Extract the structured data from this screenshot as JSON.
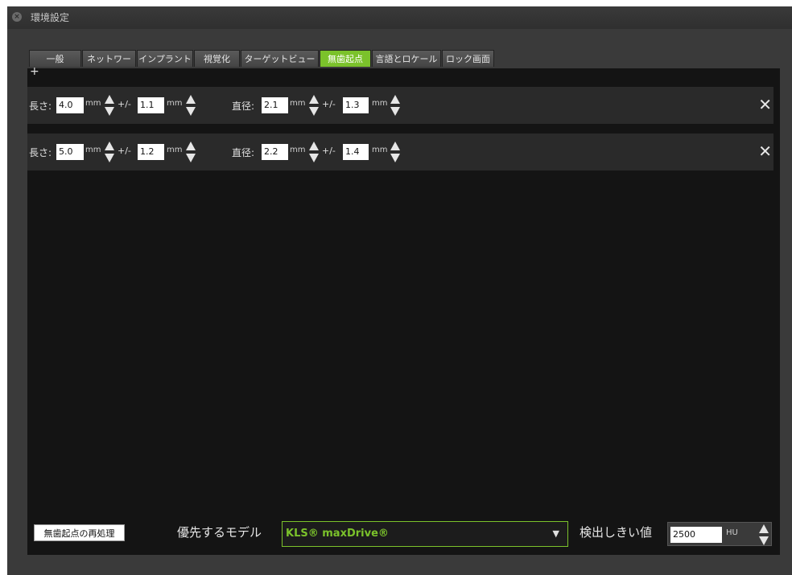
{
  "window": {
    "title": "環境設定"
  },
  "tabs": [
    {
      "label": "一般",
      "active": false
    },
    {
      "label": "ネットワーク",
      "active": false
    },
    {
      "label": "インプラント",
      "active": false
    },
    {
      "label": "視覚化",
      "active": false
    },
    {
      "label": "ターゲットビュー",
      "active": false
    },
    {
      "label": "無歯起点",
      "active": true
    },
    {
      "label": "言語とロケール",
      "active": false
    },
    {
      "label": "ロック画面",
      "active": false
    }
  ],
  "add_label": "+",
  "rows": [
    {
      "length_label": "長さ:",
      "length": "4.0",
      "length_tol": "1.1",
      "diameter_label": "直径:",
      "diameter": "2.1",
      "diameter_tol": "1.3"
    },
    {
      "length_label": "長さ:",
      "length": "5.0",
      "length_tol": "1.2",
      "diameter_label": "直径:",
      "diameter": "2.2",
      "diameter_tol": "1.4"
    }
  ],
  "unit_mm": "mm",
  "tol_sep": "+/-",
  "remove_glyph": "✕",
  "bottom": {
    "reprocess_label": "無歯起点の再処理",
    "preferred_model_label": "優先するモデル",
    "preferred_model_value": "KLS® maxDrive®",
    "threshold_label": "検出しきい値",
    "threshold_value": "2500",
    "threshold_unit": "HU"
  },
  "colors": {
    "accent": "#7bc22b"
  },
  "icons": [
    "close-window-icon",
    "spinner-up-down-icon",
    "remove-row-icon",
    "dropdown-arrow-icon"
  ]
}
